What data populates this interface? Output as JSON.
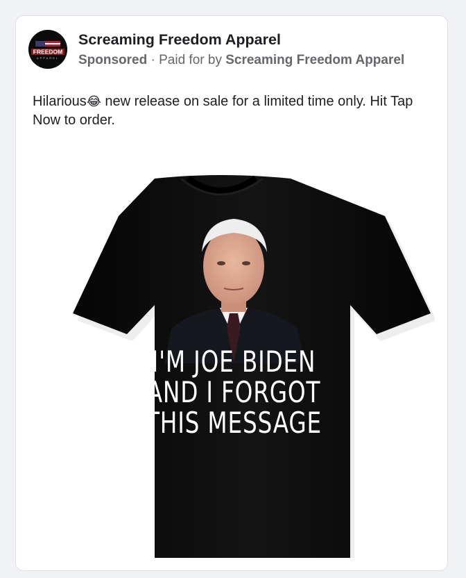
{
  "post": {
    "page_name": "Screaming Freedom Apparel",
    "sponsored_label": "Sponsored",
    "separator": "·",
    "paid_for_prefix": "Paid for by",
    "paid_for_name": "Screaming Freedom Apparel",
    "caption_before_emoji": "Hilarious",
    "caption_emoji": "😂",
    "caption_after_emoji": " new release on sale for a limited time only. Hit Tap Now to order."
  },
  "avatar": {
    "logo_text": "FREEDOM",
    "logo_subtext": "APPAREL"
  },
  "shirt": {
    "line1": "I'M JOE BIDEN",
    "line2": "AND I FORGOT",
    "line3": "THIS MESSAGE",
    "color": "#0d0d0d"
  },
  "colors": {
    "background": "#f0f2f5",
    "card": "#ffffff",
    "primary_text": "#1c1e21",
    "secondary_text": "#65676b"
  }
}
